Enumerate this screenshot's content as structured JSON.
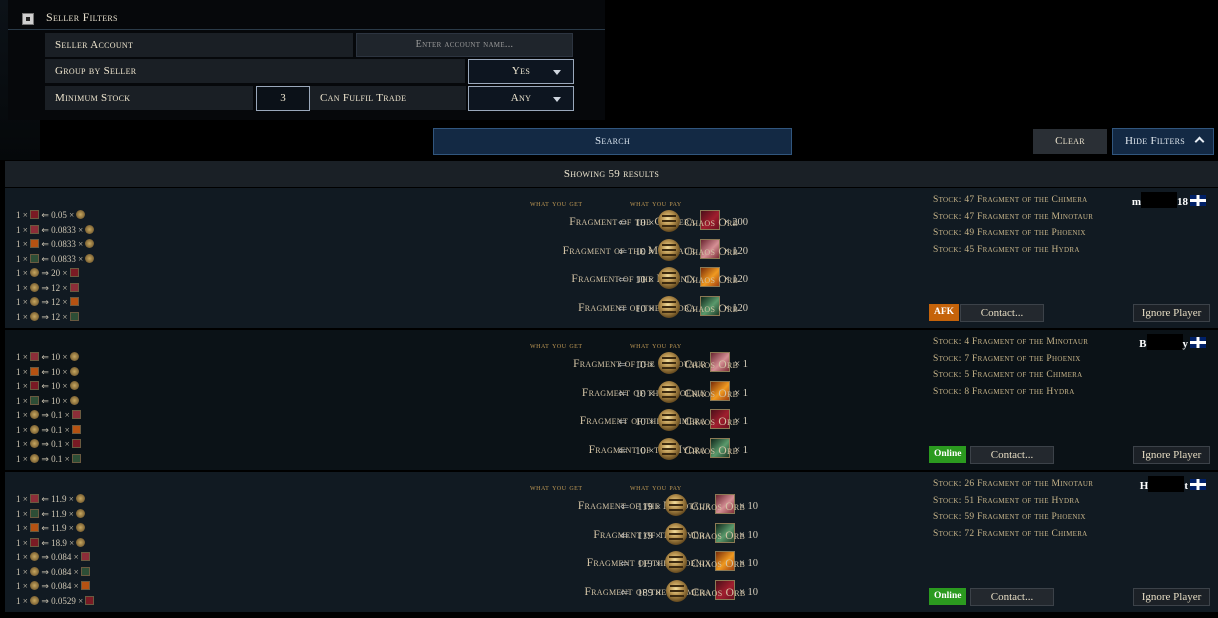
{
  "filters": {
    "title": "Seller Filters",
    "seller_account_label": "Seller Account",
    "seller_account_placeholder": "Enter account name...",
    "group_label": "Group by Seller",
    "group_value": "Yes",
    "min_stock_label": "Minimum Stock",
    "min_stock_value": "3",
    "fulfil_label": "Can Fulfil Trade",
    "fulfil_value": "Any"
  },
  "actions": {
    "search": "Search",
    "clear": "Clear",
    "hide_filters": "Hide Filters"
  },
  "results_label": "Showing 59 results",
  "col_get": "what you get",
  "col_pay": "what you pay",
  "pay_item": "Chaos Orb",
  "contact_label": "Contact...",
  "ignore_label": "Ignore Player",
  "listings": [
    {
      "seller": {
        "pre": "m",
        "post": "18"
      },
      "status": "AFK",
      "rates": [
        {
          "a": "1 ×",
          "ai": "chimera",
          "op": "⇐",
          "b": "0.05 ×",
          "bi": "orb"
        },
        {
          "a": "1 ×",
          "ai": "minotaur",
          "op": "⇐",
          "b": "0.0833 ×",
          "bi": "orb"
        },
        {
          "a": "1 ×",
          "ai": "phoenix",
          "op": "⇐",
          "b": "0.0833 ×",
          "bi": "orb"
        },
        {
          "a": "1 ×",
          "ai": "hydra",
          "op": "⇐",
          "b": "0.0833 ×",
          "bi": "orb"
        },
        {
          "a": "1 ×",
          "ai": "orb",
          "op": "⇒",
          "b": "20 ×",
          "bi": "chimera"
        },
        {
          "a": "1 ×",
          "ai": "orb",
          "op": "⇒",
          "b": "12 ×",
          "bi": "minotaur"
        },
        {
          "a": "1 ×",
          "ai": "orb",
          "op": "⇒",
          "b": "12 ×",
          "bi": "phoenix"
        },
        {
          "a": "1 ×",
          "ai": "orb",
          "op": "⇒",
          "b": "12 ×",
          "bi": "hydra"
        }
      ],
      "trades": [
        {
          "name": "Fragment of the Chimera",
          "icon": "chimera",
          "qty": "× 200",
          "pay": "10 ×"
        },
        {
          "name": "Fragment of the Minotaur",
          "icon": "minotaur",
          "qty": "× 120",
          "pay": "10 ×"
        },
        {
          "name": "Fragment of the Phoenix",
          "icon": "phoenix",
          "qty": "× 120",
          "pay": "10 ×"
        },
        {
          "name": "Fragment of the Hydra",
          "icon": "hydra",
          "qty": "× 120",
          "pay": "10 ×"
        }
      ],
      "stock": [
        "Stock: 47 Fragment of the Chimera",
        "Stock: 47 Fragment of the Minotaur",
        "Stock: 49 Fragment of the Phoenix",
        "Stock: 45 Fragment of the Hydra"
      ]
    },
    {
      "seller": {
        "pre": "B",
        "post": "y"
      },
      "status": "Online",
      "rates": [
        {
          "a": "1 ×",
          "ai": "minotaur",
          "op": "⇐",
          "b": "10 ×",
          "bi": "orb"
        },
        {
          "a": "1 ×",
          "ai": "phoenix",
          "op": "⇐",
          "b": "10 ×",
          "bi": "orb"
        },
        {
          "a": "1 ×",
          "ai": "chimera",
          "op": "⇐",
          "b": "10 ×",
          "bi": "orb"
        },
        {
          "a": "1 ×",
          "ai": "hydra",
          "op": "⇐",
          "b": "10 ×",
          "bi": "orb"
        },
        {
          "a": "1 ×",
          "ai": "orb",
          "op": "⇒",
          "b": "0.1 ×",
          "bi": "minotaur"
        },
        {
          "a": "1 ×",
          "ai": "orb",
          "op": "⇒",
          "b": "0.1 ×",
          "bi": "phoenix"
        },
        {
          "a": "1 ×",
          "ai": "orb",
          "op": "⇒",
          "b": "0.1 ×",
          "bi": "chimera"
        },
        {
          "a": "1 ×",
          "ai": "orb",
          "op": "⇒",
          "b": "0.1 ×",
          "bi": "hydra"
        }
      ],
      "trades": [
        {
          "name": "Fragment of the Minotaur",
          "icon": "minotaur",
          "qty": "× 1",
          "pay": "10 ×"
        },
        {
          "name": "Fragment of the Phoenix",
          "icon": "phoenix",
          "qty": "× 1",
          "pay": "10 ×"
        },
        {
          "name": "Fragment of the Chimera",
          "icon": "chimera",
          "qty": "× 1",
          "pay": "10 ×"
        },
        {
          "name": "Fragment of the Hydra",
          "icon": "hydra",
          "qty": "× 1",
          "pay": "10 ×"
        }
      ],
      "stock": [
        "Stock: 4 Fragment of the Minotaur",
        "Stock: 7 Fragment of the Phoenix",
        "Stock: 5 Fragment of the Chimera",
        "Stock: 8 Fragment of the Hydra"
      ]
    },
    {
      "seller": {
        "pre": "H",
        "post": "t"
      },
      "status": "Online",
      "rates": [
        {
          "a": "1 ×",
          "ai": "minotaur",
          "op": "⇐",
          "b": "11.9 ×",
          "bi": "orb"
        },
        {
          "a": "1 ×",
          "ai": "hydra",
          "op": "⇐",
          "b": "11.9 ×",
          "bi": "orb"
        },
        {
          "a": "1 ×",
          "ai": "phoenix",
          "op": "⇐",
          "b": "11.9 ×",
          "bi": "orb"
        },
        {
          "a": "1 ×",
          "ai": "chimera",
          "op": "⇐",
          "b": "18.9 ×",
          "bi": "orb"
        },
        {
          "a": "1 ×",
          "ai": "orb",
          "op": "⇒",
          "b": "0.084 ×",
          "bi": "minotaur"
        },
        {
          "a": "1 ×",
          "ai": "orb",
          "op": "⇒",
          "b": "0.084 ×",
          "bi": "hydra"
        },
        {
          "a": "1 ×",
          "ai": "orb",
          "op": "⇒",
          "b": "0.084 ×",
          "bi": "phoenix"
        },
        {
          "a": "1 ×",
          "ai": "orb",
          "op": "⇒",
          "b": "0.0529 ×",
          "bi": "chimera"
        }
      ],
      "trades": [
        {
          "name": "Fragment of the Minotaur",
          "icon": "minotaur",
          "qty": "× 10",
          "pay": "119 ×"
        },
        {
          "name": "Fragment of the Hydra",
          "icon": "hydra",
          "qty": "× 10",
          "pay": "119 ×"
        },
        {
          "name": "Fragment of the Phoenix",
          "icon": "phoenix",
          "qty": "× 10",
          "pay": "119 ×"
        },
        {
          "name": "Fragment of the Chimera",
          "icon": "chimera",
          "qty": "× 10",
          "pay": "189 ×"
        }
      ],
      "stock": [
        "Stock: 26 Fragment of the Minotaur",
        "Stock: 51 Fragment of the Hydra",
        "Stock: 59 Fragment of the Phoenix",
        "Stock: 72 Fragment of the Chimera"
      ]
    }
  ]
}
